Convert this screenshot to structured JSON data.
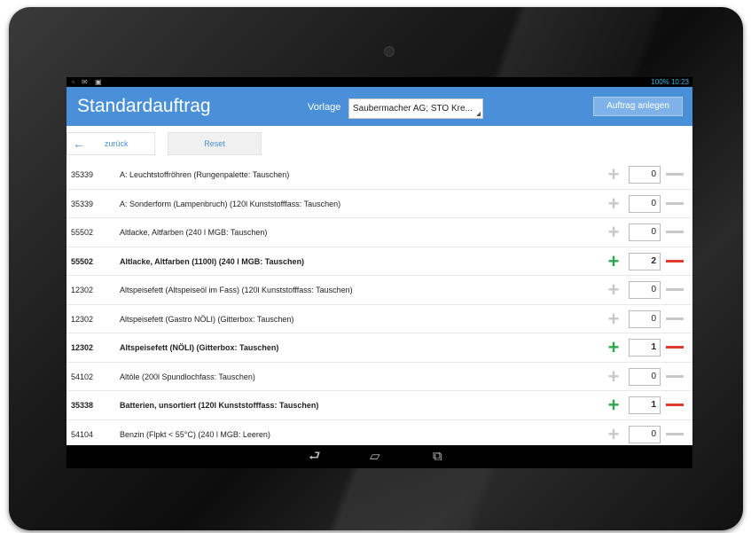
{
  "status_bar": {
    "left_icons": "▫ ✉ ▣",
    "right": "100% 10:23"
  },
  "header": {
    "title": "Standardauftrag",
    "vorlage_label": "Vorlage",
    "vorlage_value": "Saubermacher AG; STO Kre...",
    "create_button": "Auftrag anlegen"
  },
  "toolbar": {
    "back_label": "zurück",
    "reset_label": "Reset"
  },
  "rows": [
    {
      "code": "35339",
      "desc": "A: Leuchtstoffröhren (Rungenpalette: Tauschen)",
      "qty": "0",
      "bold": false
    },
    {
      "code": "35339",
      "desc": "A: Sonderform (Lampenbruch) (120l Kunststofffass: Tauschen)",
      "qty": "0",
      "bold": false
    },
    {
      "code": "55502",
      "desc": "Altlacke, Altfarben (240 l MGB: Tauschen)",
      "qty": "0",
      "bold": false
    },
    {
      "code": "55502",
      "desc": "Altlacke, Altfarben (1100l) (240 l MGB: Tauschen)",
      "qty": "2",
      "bold": true
    },
    {
      "code": "12302",
      "desc": "Altspeisefett (Altspeiseöl im Fass) (120l Kunststofffass: Tauschen)",
      "qty": "0",
      "bold": false
    },
    {
      "code": "12302",
      "desc": "Altspeisefett (Gastro NÖLI) (Gitterbox: Tauschen)",
      "qty": "0",
      "bold": false
    },
    {
      "code": "12302",
      "desc": "Altspeisefett (NÖLI) (Gitterbox: Tauschen)",
      "qty": "1",
      "bold": true
    },
    {
      "code": "54102",
      "desc": "Altöle (200l Spundlochfass: Tauschen)",
      "qty": "0",
      "bold": false
    },
    {
      "code": "35338",
      "desc": "Batterien, unsortiert (120l Kunststofffass: Tauschen)",
      "qty": "1",
      "bold": true
    },
    {
      "code": "54104",
      "desc": "Benzin (Flpkt < 55°C) (240 l MGB: Leeren)",
      "qty": "0",
      "bold": false
    }
  ],
  "icons": {
    "back": "arrow-left-icon",
    "plus": "plus-icon",
    "minus": "minus-icon",
    "nav_back": "back-icon",
    "nav_home": "home-icon",
    "nav_recents": "recents-icon"
  },
  "colors": {
    "accent": "#4a90d9",
    "plus_active": "#2aa84a",
    "minus_active": "#e03a2f",
    "inactive": "#c8c8c8"
  }
}
